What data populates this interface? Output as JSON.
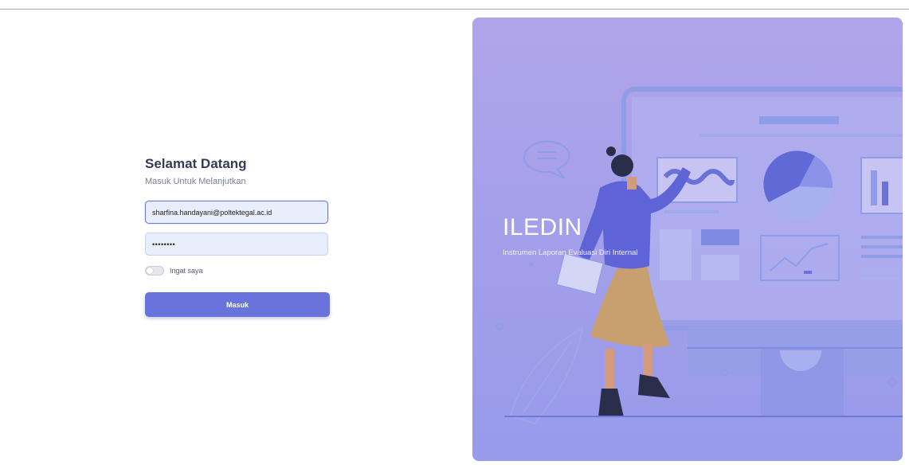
{
  "login": {
    "title": "Selamat Datang",
    "subtitle": "Masuk Untuk Melanjutkan",
    "email_value": "sharfina.handayani@poltektegal.ac.id",
    "password_value": "••••••••",
    "remember_label": "Ingat saya",
    "submit_label": "Masuk"
  },
  "hero": {
    "brand": "ILEDIN",
    "tagline": "Instrumen Laporan Evaluasi Diri Internal"
  },
  "colors": {
    "accent": "#6874db",
    "hero_bg": "#a29eea",
    "input_bg": "#e8eefc"
  }
}
